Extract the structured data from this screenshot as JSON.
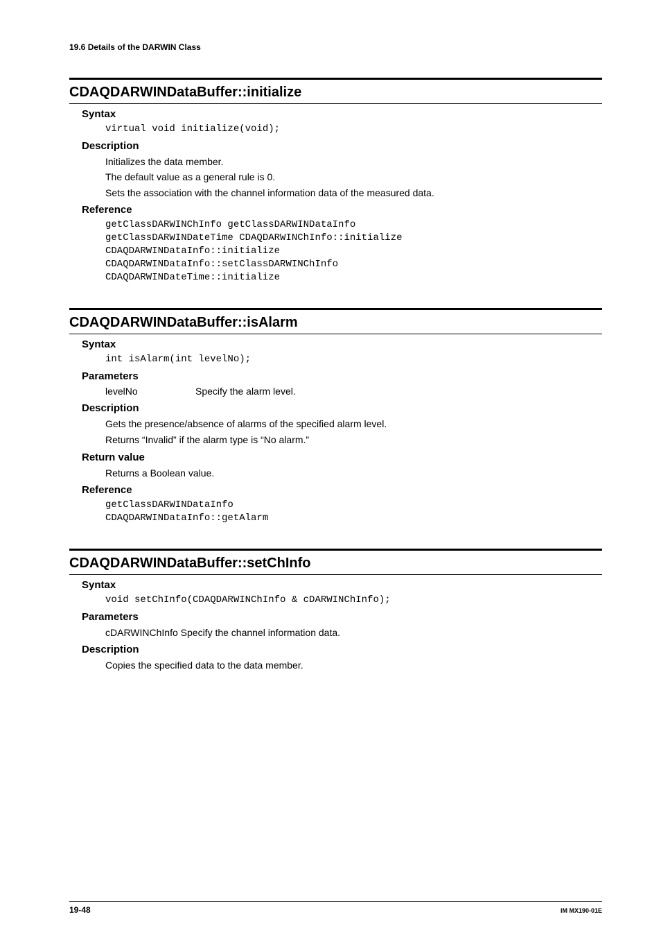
{
  "running_head": "19.6  Details of the DARWIN Class",
  "sections": [
    {
      "title": "CDAQDARWINDataBuffer::initialize",
      "blocks": [
        {
          "head": "Syntax",
          "type": "code",
          "code": "virtual void initialize(void);"
        },
        {
          "head": "Description",
          "type": "text",
          "lines": [
            "Initializes the data member.",
            "The default value as a general rule is 0.",
            "Sets the association with the channel information data of the measured data."
          ]
        },
        {
          "head": "Reference",
          "type": "code",
          "code": "getClassDARWINChInfo getClassDARWINDataInfo\ngetClassDARWINDateTime CDAQDARWINChInfo::initialize\nCDAQDARWINDataInfo::initialize\nCDAQDARWINDataInfo::setClassDARWINChInfo\nCDAQDARWINDateTime::initialize"
        }
      ]
    },
    {
      "title": "CDAQDARWINDataBuffer::isAlarm",
      "blocks": [
        {
          "head": "Syntax",
          "type": "code",
          "code": "int isAlarm(int levelNo);"
        },
        {
          "head": "Parameters",
          "type": "param",
          "params": [
            {
              "name": "levelNo",
              "desc": "Specify the alarm level."
            }
          ]
        },
        {
          "head": "Description",
          "type": "text",
          "lines": [
            "Gets the presence/absence of alarms of the specified alarm level.",
            "Returns “Invalid” if the alarm type is “No alarm.”"
          ]
        },
        {
          "head": "Return value",
          "type": "text",
          "lines": [
            "Returns a Boolean value."
          ]
        },
        {
          "head": "Reference",
          "type": "code",
          "code": "getClassDARWINDataInfo\nCDAQDARWINDataInfo::getAlarm"
        }
      ]
    },
    {
      "title": "CDAQDARWINDataBuffer::setChInfo",
      "blocks": [
        {
          "head": "Syntax",
          "type": "code",
          "code": "void setChInfo(CDAQDARWINChInfo & cDARWINChInfo);"
        },
        {
          "head": "Parameters",
          "type": "text",
          "lines": [
            "cDARWINChInfo Specify the channel information data."
          ]
        },
        {
          "head": "Description",
          "type": "text",
          "lines": [
            "Copies the specified data to the data member."
          ]
        }
      ]
    }
  ],
  "footer": {
    "left": "19-48",
    "right": "IM MX190-01E"
  }
}
